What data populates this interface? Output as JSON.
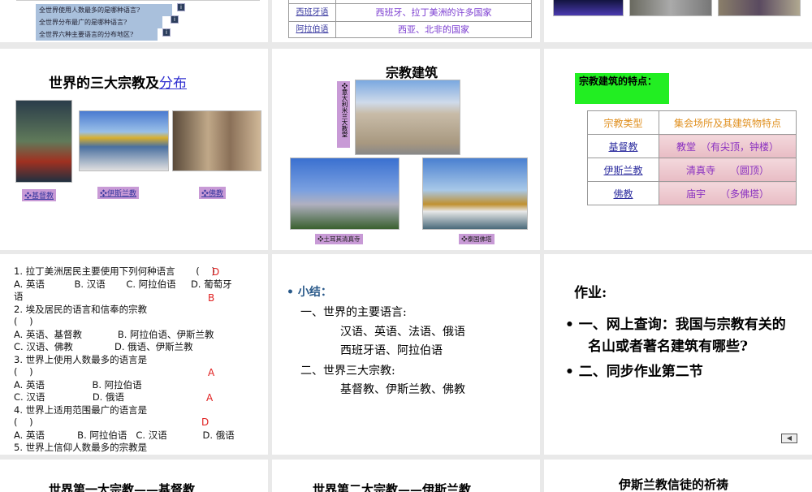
{
  "slide1": {
    "questions": [
      "全世界使用人数最多的是哪种语言?",
      "全世界分布最广的是哪种语言?",
      "全世界六种主要语言的分布地区?"
    ],
    "info_icon": "info-icon"
  },
  "slide2": {
    "rows": [
      {
        "lang": "西班牙语",
        "region": "西班牙、拉丁美洲的许多国家"
      },
      {
        "lang": "阿拉伯语",
        "region": "西亚、北非的国家"
      }
    ]
  },
  "slide4": {
    "title_prefix": "世界的三大宗教及",
    "title_link": "分布",
    "labels": [
      "❖基督教",
      "❖伊斯兰教",
      "❖佛教"
    ]
  },
  "slide5": {
    "title": "宗教建筑",
    "labels": [
      "❖意大利米兰大教堂",
      "❖土耳其清真寺",
      "❖泰国佛塔"
    ]
  },
  "slide6": {
    "heading": "宗教建筑的特点：",
    "header": [
      "宗教类型",
      "集会场所及其建筑物特点"
    ],
    "rows": [
      {
        "type": "基督教",
        "feature": "教堂　（有尖顶，钟楼）"
      },
      {
        "type": "伊斯兰教",
        "feature": "清真寺　　（圆顶）"
      },
      {
        "type": "佛教",
        "feature": "庙宇　　（多佛塔）"
      }
    ]
  },
  "slide7": {
    "lines": [
      {
        "text": "1. 拉丁美洲居民主要使用下列何种语言       (    )",
        "answer": "D"
      },
      {
        "text": "A. 英语          B. 汉语       C. 阿拉伯语     D. 葡萄牙",
        "answer": ""
      },
      {
        "text": "语",
        "answer": "B"
      },
      {
        "text": "2. 埃及居民的语言和信奉的宗教",
        "answer": ""
      },
      {
        "text": "(    )",
        "answer": ""
      },
      {
        "text": "A. 英语、基督教            B. 阿拉伯语、伊斯兰教",
        "answer": ""
      },
      {
        "text": "C. 汉语、佛教              D. 俄语、伊斯兰教",
        "answer": ""
      },
      {
        "text": "3. 世界上使用人数最多的语言是",
        "answer": ""
      },
      {
        "text": "(    )",
        "answer": "A"
      },
      {
        "text": "A. 英语                B. 阿拉伯语",
        "answer": ""
      },
      {
        "text": "C. 汉语                D. 俄语",
        "answer": "A"
      },
      {
        "text": "4. 世界上适用范围最广的语言是",
        "answer": ""
      },
      {
        "text": "(    )",
        "answer": "D"
      },
      {
        "text": "A. 英语           B. 阿拉伯语   C. 汉语            D. 俄语",
        "answer": ""
      },
      {
        "text": "5. 世界上信仰人数最多的宗教是",
        "answer": ""
      }
    ]
  },
  "slide8": {
    "bullet": "小结：",
    "lines": [
      "一、世界的主要语言:",
      "汉语、英语、法语、俄语",
      "西班牙语、阿拉伯语",
      "二、世界三大宗教:",
      "基督教、伊斯兰教、佛教"
    ]
  },
  "slide9": {
    "title": "作业:",
    "items": [
      "一、网上查询：我国与宗教有关的名山或者著名建筑有哪些?",
      "二、同步作业第二节"
    ],
    "back_button": "◀"
  },
  "slide10": {
    "title": "世界第一大宗教——基督教"
  },
  "slide11": {
    "title": "世界第二大宗教——伊斯兰教"
  },
  "slide12": {
    "title": "伊斯兰教信徒的祈祷"
  }
}
